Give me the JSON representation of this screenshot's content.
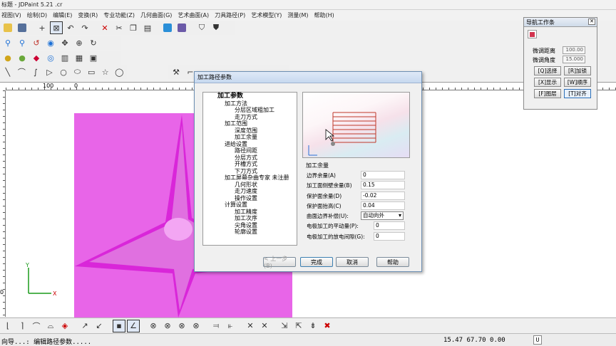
{
  "app": {
    "title": "标题 - JDPaint 5.21 .cr"
  },
  "menu": [
    "视图(V)",
    "绘制(D)",
    "编辑(E)",
    "变换(R)",
    "专业功能(Z)",
    "几何曲面(G)",
    "艺术曲面(A)",
    "刀具路径(P)",
    "艺术模型(Y)",
    "测量(M)",
    "帮助(H)"
  ],
  "ruler": {
    "h_labels": [
      "100",
      "0",
      "100"
    ],
    "v_labels": [
      "0"
    ]
  },
  "axes": {
    "x": "X",
    "y": "Y"
  },
  "dialog": {
    "title": "加工路径参数",
    "tree": [
      "加工参数",
      "加工方法",
      "分层区域粗加工",
      "走刀方式",
      "加工范围",
      "深度范围",
      "加工余量",
      "进给设置",
      "路径间距",
      "分层方式",
      "开槽方式",
      "下刀方式",
      "加工屏幕杂曲专家 未注册",
      "几何形状",
      "走刀速度",
      "操作设置",
      "计算设置",
      "加工精度",
      "加工次序",
      "尖角设置",
      "轮廓设置"
    ],
    "section": "加工余量",
    "params": [
      {
        "label": "边界余量(A)",
        "value": "0"
      },
      {
        "label": "加工面侧壁余量(B)",
        "value": "0.15"
      },
      {
        "label": "保护面余量(D)",
        "value": "-0.02"
      },
      {
        "label": "保护面抬高(C)",
        "value": "0.04"
      },
      {
        "label": "曲面边界补偿(U):",
        "value": "自动向外"
      },
      {
        "label": "电极加工的平动量(P):",
        "value": "0"
      },
      {
        "label": "电极加工的放电间隙(G):",
        "value": "0"
      }
    ],
    "buttons": {
      "prev": "< 上一步(B)",
      "finish": "完成",
      "cancel": "取消",
      "help": "帮助"
    }
  },
  "nav": {
    "title": "导航工作条",
    "fields": [
      {
        "label": "微调距离",
        "value": "100.00"
      },
      {
        "label": "微调角度",
        "value": "15.000"
      }
    ],
    "buttons": [
      "[Q]选择",
      "[R]加锁",
      "[X]显示",
      "[W]顺序",
      "[F]图层",
      "[T]对齐"
    ]
  },
  "status": {
    "prompt": "向导...: 编辑路径参数.....",
    "coords": "15.47 67.70 0.00",
    "mode": "U"
  },
  "colors": {
    "magenta": "#e865e8",
    "star": "#d926d9",
    "star_light": "#f3a6f3"
  }
}
